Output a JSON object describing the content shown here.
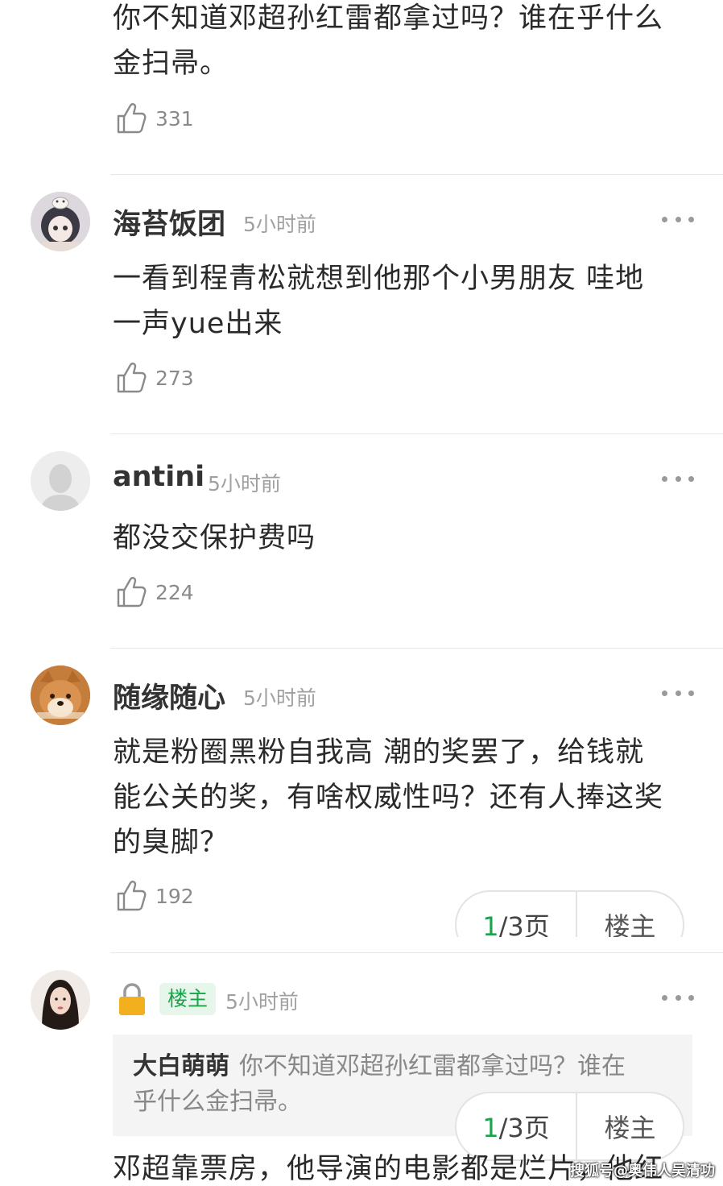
{
  "comments": [
    {
      "text_lines": [
        "你不知道邓超孙红雷都拿过吗？谁在乎什么",
        "金扫帚。"
      ],
      "likes": "331"
    },
    {
      "username": "海苔饭团",
      "time": "5小时前",
      "text_lines": [
        "一看到程青松就想到他那个小男朋友 哇地",
        "一声yue出来"
      ],
      "likes": "273"
    },
    {
      "username": "antini",
      "time": "5小时前",
      "text_lines": [
        "都没交保护费吗"
      ],
      "likes": "224"
    },
    {
      "username": "随缘随心",
      "time": "5小时前",
      "text_lines": [
        "就是粉圈黑粉自我高  潮的奖罢了，给钱就",
        "能公关的奖，有啥权威性吗？还有人捧这奖",
        "的臭脚？"
      ],
      "likes": "192"
    },
    {
      "badge": "楼主",
      "time": "5小时前",
      "quote_user": "大白萌萌",
      "quote_lines": [
        "你不知道邓超孙红雷都拿过吗？谁在",
        "乎什么金扫帚。"
      ],
      "text_lines": [
        "邓超靠票房，他导演的电影都是烂片，他红"
      ]
    }
  ],
  "pager": {
    "current": "1",
    "total": "/3页",
    "owner_label": "楼主"
  },
  "watermark": "搜狐号@奥伟人吴清功",
  "colors": {
    "accent_green": "#1aa34a",
    "badge_bg": "#e6f6ea",
    "lock": "#f2b01e"
  }
}
